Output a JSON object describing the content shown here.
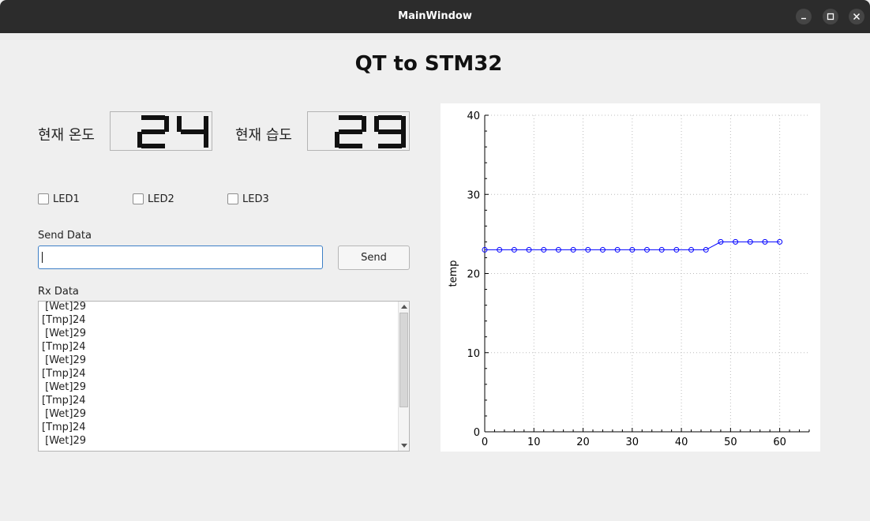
{
  "window": {
    "title": "MainWindow"
  },
  "heading": "QT to STM32",
  "readings": {
    "temp_label": "현재 온도",
    "temp_value": "24",
    "humid_label": "현재 습도",
    "humid_value": "29"
  },
  "leds": [
    "LED1",
    "LED2",
    "LED3"
  ],
  "send": {
    "label": "Send Data",
    "value": "",
    "button": "Send"
  },
  "rx": {
    "label": "Rx Data",
    "lines": [
      " [Wet]29",
      "[Tmp]24",
      " [Wet]29",
      "[Tmp]24",
      " [Wet]29",
      "[Tmp]24",
      " [Wet]29",
      "[Tmp]24",
      " [Wet]29",
      "[Tmp]24",
      " [Wet]29"
    ]
  },
  "chart_data": {
    "type": "line",
    "ylabel": "temp",
    "xlabel": "",
    "xlim": [
      0,
      66
    ],
    "ylim": [
      0,
      40
    ],
    "xticks": [
      0,
      10,
      20,
      30,
      40,
      50,
      60
    ],
    "yticks": [
      0,
      10,
      20,
      30,
      40
    ],
    "grid": true,
    "color": "#0000ff",
    "x": [
      0,
      3,
      6,
      9,
      12,
      15,
      18,
      21,
      24,
      27,
      30,
      33,
      36,
      39,
      42,
      45,
      48,
      51,
      54,
      57,
      60
    ],
    "y": [
      23,
      23,
      23,
      23,
      23,
      23,
      23,
      23,
      23,
      23,
      23,
      23,
      23,
      23,
      23,
      23,
      24,
      24,
      24,
      24,
      24
    ]
  }
}
